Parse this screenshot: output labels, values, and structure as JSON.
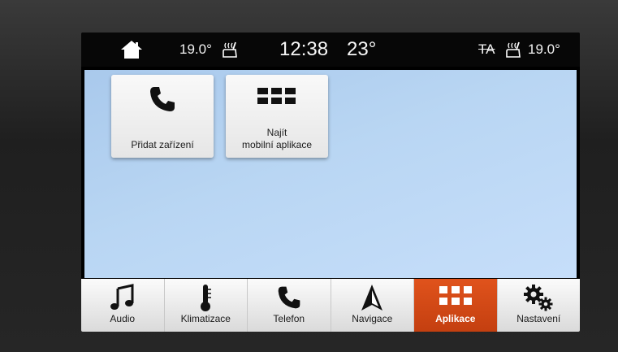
{
  "statusbar": {
    "driver_temp": "19.0°",
    "clock": "12:38",
    "outside_temp": "23°",
    "ta_label": "TA",
    "passenger_temp": "19.0°"
  },
  "tiles": [
    {
      "label": "Přidat zařízení",
      "icon": "phone-icon"
    },
    {
      "label": "Najít\nmobilní aplikace",
      "icon": "grid-icon"
    }
  ],
  "nav": {
    "items": [
      {
        "label": "Audio",
        "icon": "music-note-icon"
      },
      {
        "label": "Klimatizace",
        "icon": "thermometer-icon"
      },
      {
        "label": "Telefon",
        "icon": "phone-icon"
      },
      {
        "label": "Navigace",
        "icon": "navigation-arrow-icon"
      },
      {
        "label": "Aplikace",
        "icon": "grid-icon",
        "active": true
      },
      {
        "label": "Nastavení",
        "icon": "gears-icon"
      }
    ]
  },
  "colors": {
    "active_tab": "#d4471a",
    "screen_background": "#b9d6f3",
    "statusbar": "#070707"
  }
}
